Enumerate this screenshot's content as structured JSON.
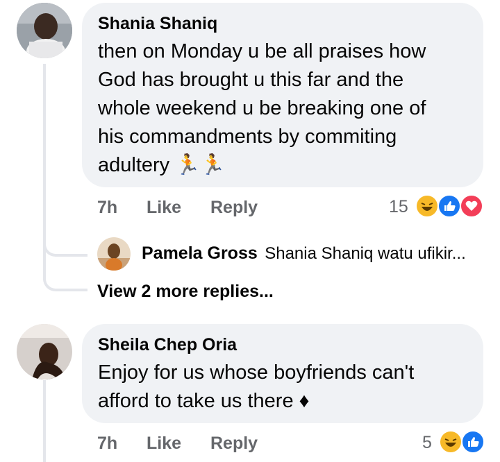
{
  "comments": [
    {
      "author": "Shania Shaniq",
      "lines": [
        "then on Monday u be all praises how",
        "God has brought u this far and the",
        "whole weekend u be breaking one of",
        "his commandments by commiting",
        "adultery 🏃🏃"
      ],
      "time": "7h",
      "like": "Like",
      "reply": "Reply",
      "reaction_count": "15",
      "reactions": [
        "haha",
        "like",
        "love"
      ]
    },
    {
      "author": "Sheila Chep Oria",
      "lines": [
        "Enjoy for us whose boyfriends can't",
        "afford to take us there ♦"
      ],
      "time": "7h",
      "like": "Like",
      "reply": "Reply",
      "reaction_count": "5",
      "reactions": [
        "haha",
        "like"
      ]
    }
  ],
  "reply_preview": {
    "author": "Pamela Gross",
    "text": "Shania Shaniq  watu ufikir..."
  },
  "view_more": "View 2 more replies...",
  "colors": {
    "bubble": "#f0f2f5",
    "meta": "#65676b",
    "like_blue": "#1877f2",
    "love_red": "#f33e58",
    "haha_yellow": "#f7b928"
  }
}
